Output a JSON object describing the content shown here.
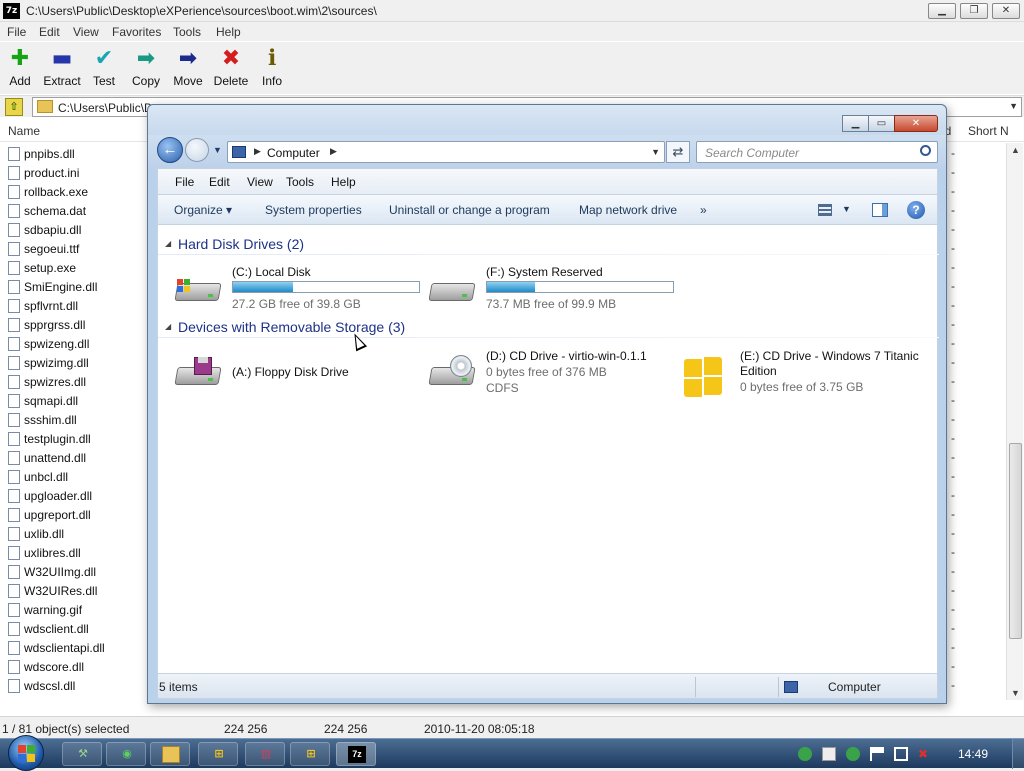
{
  "zip": {
    "title": "C:\\Users\\Public\\Desktop\\eXPerience\\sources\\boot.wim\\2\\sources\\",
    "icon_label": "7z",
    "menu": [
      "File",
      "Edit",
      "View",
      "Favorites",
      "Tools",
      "Help"
    ],
    "toolbar": [
      {
        "label": "Add",
        "icon": "plus-icon",
        "glyph": "✚",
        "color": "#16a316"
      },
      {
        "label": "Extract",
        "icon": "minus-icon",
        "glyph": "▬",
        "color": "#2436a8"
      },
      {
        "label": "Test",
        "icon": "check-icon",
        "glyph": "✔",
        "color": "#19a6b4"
      },
      {
        "label": "Copy",
        "icon": "copy-arrow-icon",
        "glyph": "➡",
        "color": "#199a84"
      },
      {
        "label": "Move",
        "icon": "move-arrow-icon",
        "glyph": "➡",
        "color": "#1b2a8c"
      },
      {
        "label": "Delete",
        "icon": "delete-x-icon",
        "glyph": "✖",
        "color": "#d61d1d"
      },
      {
        "label": "Info",
        "icon": "info-icon",
        "glyph": "ℹ",
        "color": "#6a5a00"
      }
    ],
    "address": "C:\\Users\\Public\\D",
    "columns": {
      "name": "Name",
      "id": "id",
      "short": "Short N"
    },
    "files": [
      "pnpibs.dll",
      "product.ini",
      "rollback.exe",
      "schema.dat",
      "sdbapiu.dll",
      "segoeui.ttf",
      "setup.exe",
      "SmiEngine.dll",
      "spflvrnt.dll",
      "spprgrss.dll",
      "spwizeng.dll",
      "spwizimg.dll",
      "spwizres.dll",
      "sqmapi.dll",
      "ssshim.dll",
      "testplugin.dll",
      "unattend.dll",
      "unbcl.dll",
      "upgloader.dll",
      "upgreport.dll",
      "uxlib.dll",
      "uxlibres.dll",
      "W32UIImg.dll",
      "W32UIRes.dll",
      "warning.gif",
      "wdsclient.dll",
      "wdsclientapi.dll",
      "wdscore.dll",
      "wdscsl.dll"
    ],
    "dash": "-",
    "status": {
      "selected": "1 / 81 object(s) selected",
      "size": "224 256",
      "packed": "224 256",
      "modified": "2010-11-20 08:05:18"
    }
  },
  "explorer": {
    "address": "Computer",
    "search_placeholder": "Search Computer",
    "menu": [
      "File",
      "Edit",
      "View",
      "Tools",
      "Help"
    ],
    "commands": {
      "organize": "Organize",
      "organize_arrow": "▾",
      "system_properties": "System properties",
      "uninstall": "Uninstall or change a program",
      "map_drive": "Map network drive",
      "more": "»"
    },
    "groups": {
      "hdd": {
        "title": "Hard Disk Drives (2)",
        "drives": [
          {
            "name": "(C:) Local Disk",
            "free": "27.2 GB free of 39.8 GB",
            "used_fraction": 0.32
          },
          {
            "name": "(F:) System Reserved",
            "free": "73.7 MB free of 99.9 MB",
            "used_fraction": 0.26
          }
        ]
      },
      "removable": {
        "title": "Devices with Removable Storage (3)",
        "floppy": {
          "name": "(A:) Floppy Disk Drive"
        },
        "cd_d": {
          "name": "(D:) CD Drive - virtio-win-0.1.1",
          "free": "0 bytes free of 376 MB",
          "fs": "CDFS"
        },
        "cd_e": {
          "name": "(E:) CD Drive - Windows 7 Titanic",
          "name2": "Edition",
          "free": "0 bytes free of 3.75 GB"
        }
      }
    },
    "status": {
      "items": "5 items",
      "location": "Computer"
    }
  },
  "taskbar": {
    "clock": "14:49"
  },
  "colors": {
    "accent": "#1e3287",
    "capacity": "#1f8ac6"
  }
}
